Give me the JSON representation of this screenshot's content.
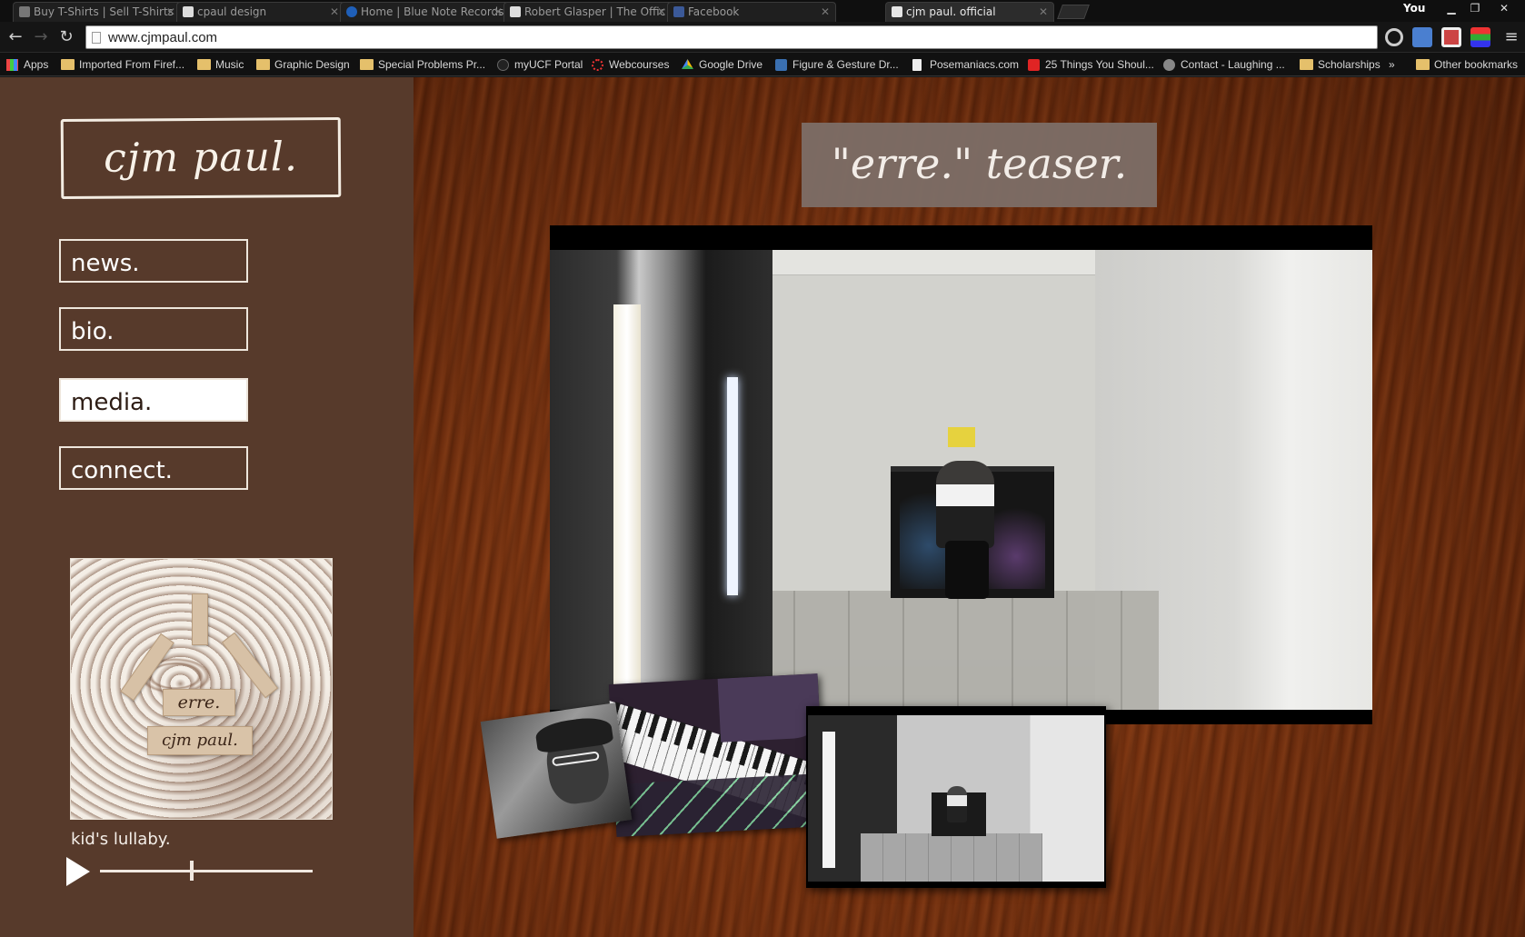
{
  "browser": {
    "tabs": [
      {
        "title": "Buy T-Shirts | Sell T-Shirts",
        "active": false
      },
      {
        "title": "cpaul design",
        "active": false
      },
      {
        "title": "Home | Blue Note Records",
        "active": false
      },
      {
        "title": "Robert Glasper | The Offic",
        "active": false
      },
      {
        "title": "Facebook",
        "active": false
      },
      {
        "title": "cjm paul. official",
        "active": true
      }
    ],
    "profile": "You",
    "url": "www.cjmpaul.com",
    "bookmarks": [
      "Apps",
      "Imported From Firef...",
      "Music",
      "Graphic Design",
      "Special Problems Pr...",
      "myUCF Portal",
      "Webcourses",
      "Google Drive",
      "Figure & Gesture Dr...",
      "Posemaniacs.com",
      "25 Things You Shoul...",
      "Contact - Laughing ...",
      "Scholarships",
      "»",
      "Other bookmarks"
    ]
  },
  "site": {
    "logo": "cjm paul.",
    "nav": [
      {
        "label": "news.",
        "active": false
      },
      {
        "label": "bio.",
        "active": false
      },
      {
        "label": "media.",
        "active": true
      },
      {
        "label": "connect.",
        "active": false
      }
    ],
    "album": {
      "title": "erre.",
      "artist": "cjm paul."
    },
    "player": {
      "track": "kid's lullaby.",
      "progress": 0.43
    },
    "media_heading": "\"erre.\" teaser."
  },
  "colors": {
    "sidebar": "#573a2b",
    "wood": "#7a3411",
    "heading_bg": "#7d6e67",
    "nav_active_bg": "#ffffff"
  }
}
